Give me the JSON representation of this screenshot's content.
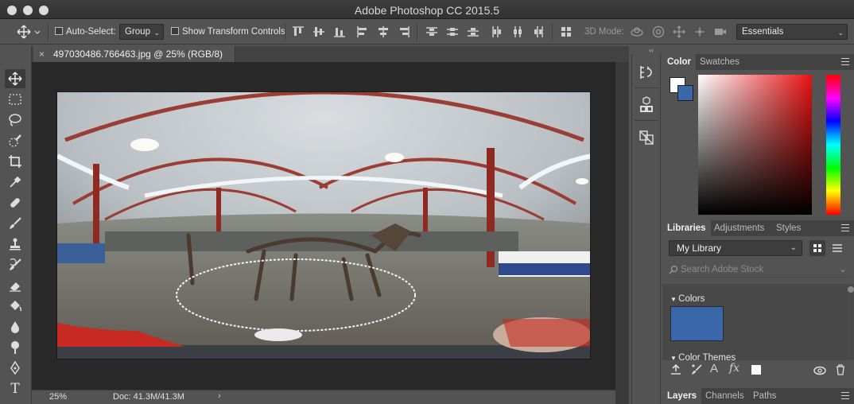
{
  "app": {
    "title": "Adobe Photoshop CC 2015.5"
  },
  "options_bar": {
    "auto_select_label": "Auto-Select:",
    "auto_select_value": "Group",
    "show_transform_label": "Show Transform Controls",
    "three_d_mode_label": "3D Mode:",
    "workspace_value": "Essentials"
  },
  "tools": [
    "move-tool",
    "marquee-tool",
    "lasso-tool",
    "quick-selection-tool",
    "crop-tool",
    "eyedropper-tool",
    "healing-brush-tool",
    "brush-tool",
    "clone-stamp-tool",
    "history-brush-tool",
    "eraser-tool",
    "paint-bucket-tool",
    "blur-tool",
    "dodge-tool",
    "pen-tool",
    "type-tool"
  ],
  "type_tool_glyph": "T",
  "document": {
    "tab_title": "497030486.766463.jpg @ 25% (RGB/8)",
    "close_glyph": "×"
  },
  "status": {
    "zoom": "25%",
    "doc_size": "Doc: 41.3M/41.3M",
    "arrow": "›"
  },
  "color_panel": {
    "tabs": [
      "Color",
      "Swatches"
    ],
    "foreground": "#ffffff",
    "background": "#3a66aa"
  },
  "libraries_panel": {
    "tabs": [
      "Libraries",
      "Adjustments",
      "Styles"
    ],
    "library_name": "My Library",
    "search_placeholder": "Search Adobe Stock",
    "sections": {
      "colors": "Colors",
      "color_themes": "Color Themes"
    },
    "swatch_color": "#3a66aa",
    "footer_text_glyph": "A",
    "footer_fx_glyph": "fx"
  },
  "layers_panel": {
    "tabs": [
      "Layers",
      "Channels",
      "Paths"
    ]
  },
  "panel_collapse": {
    "left": "››",
    "right": "‹‹"
  }
}
